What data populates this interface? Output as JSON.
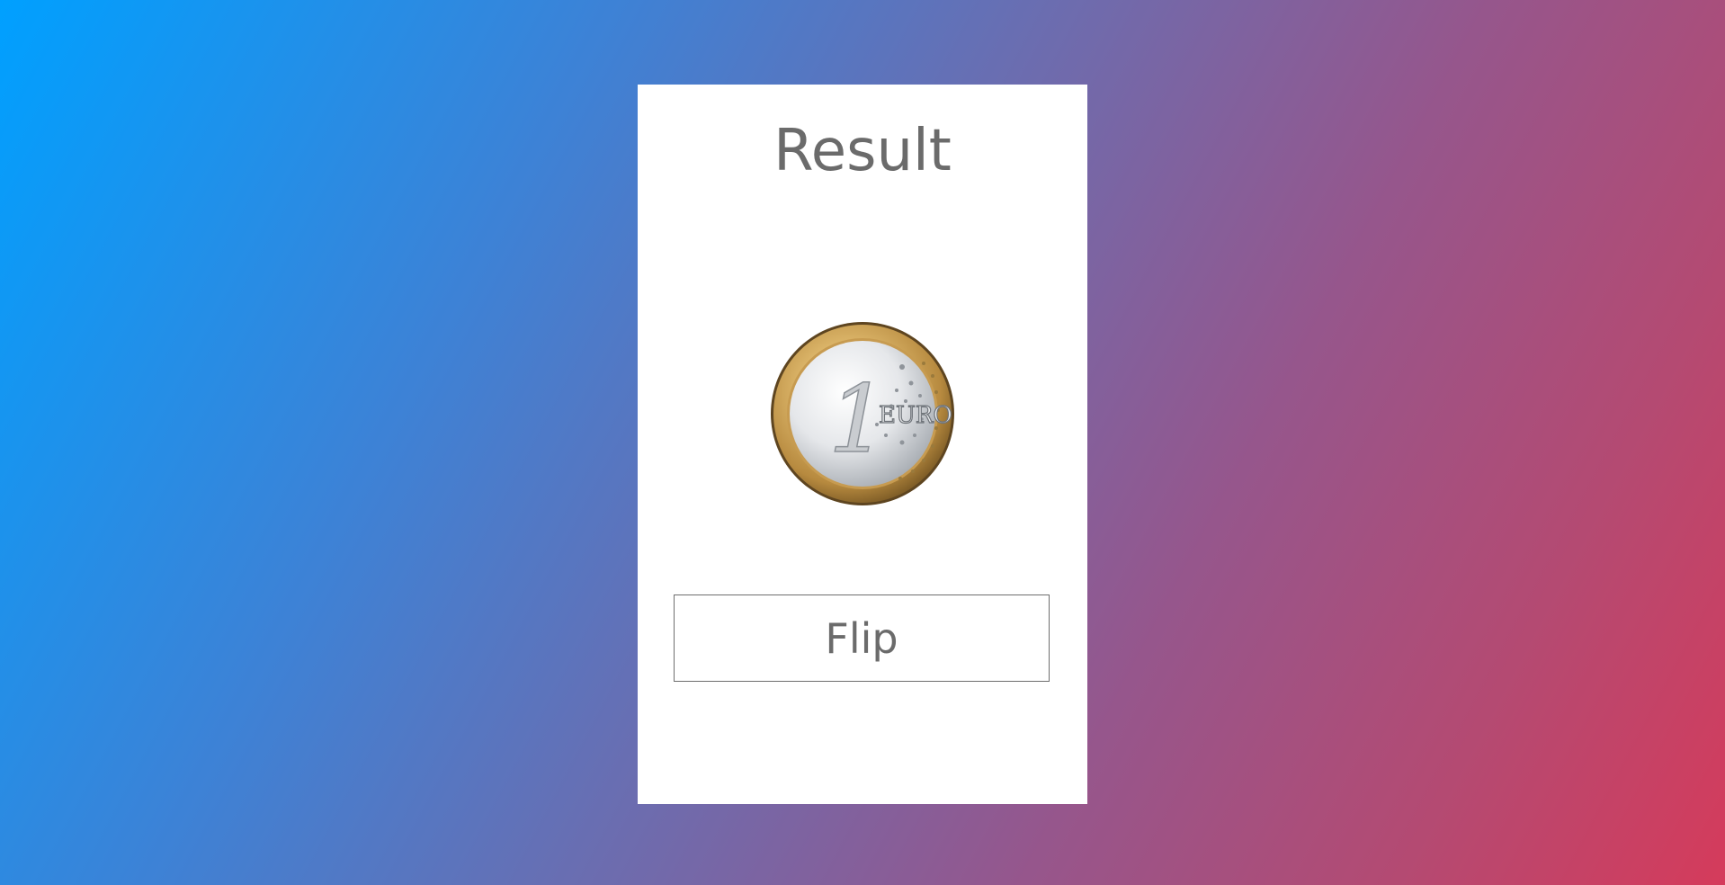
{
  "page": {
    "background_start": "#00a0ff",
    "background_end": "#d53b5b"
  },
  "card": {
    "title": "Result",
    "coin": {
      "icon": "one-euro-coin-icon",
      "denomination": "1",
      "word": "EURO"
    },
    "flip_label": "Flip"
  }
}
